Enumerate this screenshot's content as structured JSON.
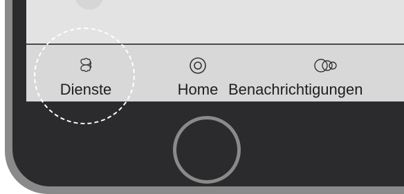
{
  "tabs": [
    {
      "label": "Dienste",
      "icon": "services-clover-icon",
      "selected": false
    },
    {
      "label": "Home",
      "icon": "home-target-icon",
      "selected": false
    },
    {
      "label": "Benachrichtigungen",
      "icon": "notifications-rings-icon",
      "selected": false
    }
  ],
  "highlight": {
    "target": "Dienste"
  },
  "colors": {
    "phone_body": "#2b2b2d",
    "phone_rim": "#8a8a8a",
    "tab_bar": "#d8d8d8",
    "content": "#e3e3e3",
    "highlight": "#ffffff"
  }
}
